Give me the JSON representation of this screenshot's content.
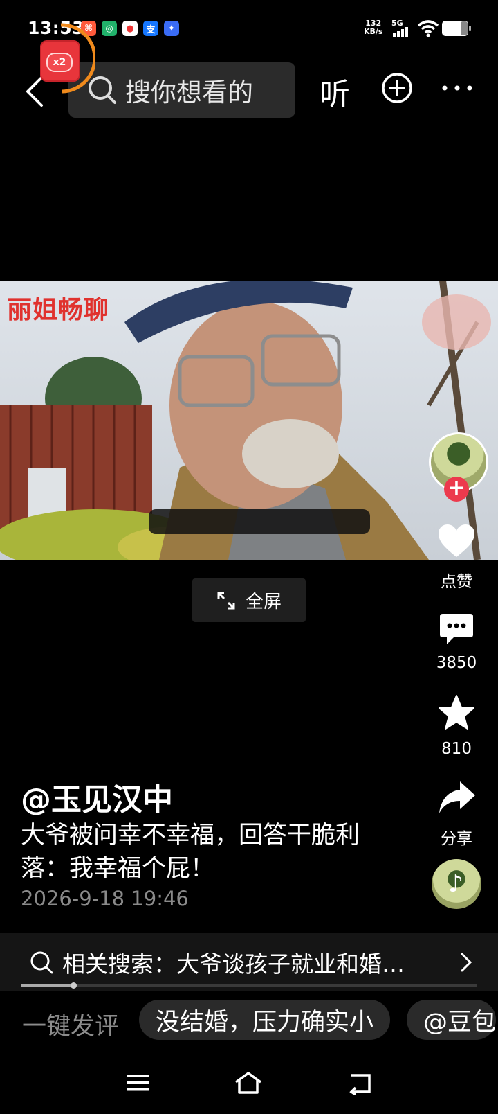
{
  "status_bar": {
    "time": "13:53",
    "apps": [
      "xiaohongshu-icon",
      "green-app-icon",
      "maps-icon",
      "alipay-icon",
      "blue-app-icon"
    ],
    "net_speed_value": "132",
    "net_speed_unit": "KB/s",
    "network": "5G"
  },
  "top_bar": {
    "search_placeholder": "搜你想看的",
    "listen_label": "听",
    "redpacket_badge": "x2"
  },
  "video": {
    "watermark": "丽姐畅聊",
    "fullscreen_label": "全屏"
  },
  "actions": {
    "like_label": "点赞",
    "comment_count": "3850",
    "favorite_count": "810",
    "share_label": "分享"
  },
  "post": {
    "author": "@玉见汉中",
    "caption": "大爷被问幸不幸福，回答干脆利落：我幸福个屁！",
    "time": "2026-9-18 19:46"
  },
  "related_search": {
    "text": "相关搜索：大爷谈孩子就业和婚…",
    "progress_fraction": 0.11
  },
  "comment_bar": {
    "one_click_label": "一键发评",
    "chips": [
      "没结婚，压力确实小",
      "@豆包"
    ]
  },
  "colors": {
    "like_accent": "#ec3a4d",
    "timer_ring": "#f08a1c"
  }
}
